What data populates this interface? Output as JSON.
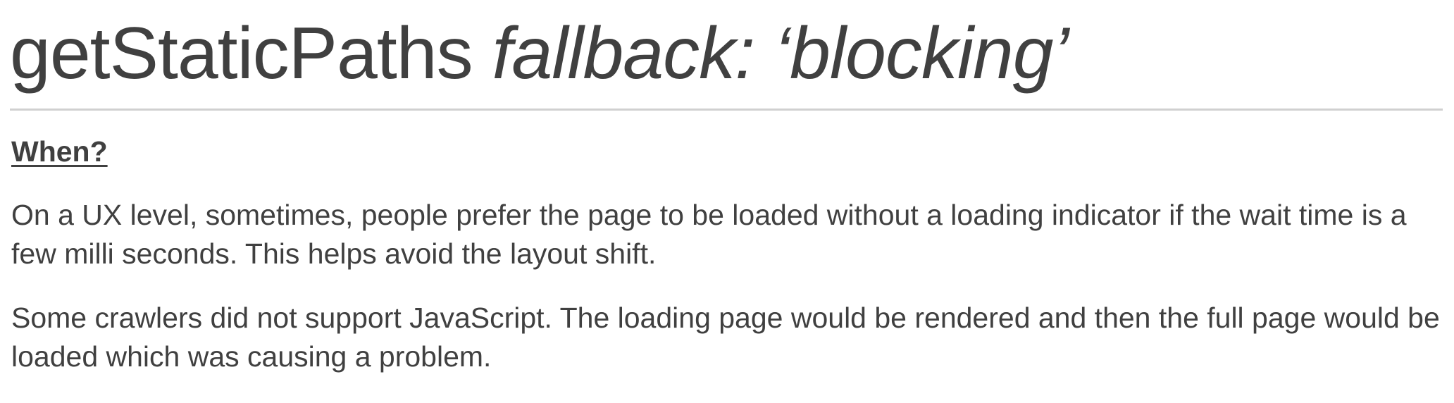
{
  "slide": {
    "title_plain": "getStaticPaths ",
    "title_emphasis": "fallback: ‘blocking’",
    "section_label": "When?",
    "paragraphs": [
      "On a UX level, sometimes, people prefer the page to be loaded without a loading indicator if the wait time is a few milli seconds. This helps avoid the layout shift.",
      "Some crawlers did not support JavaScript. The loading page would be rendered and then the full page would be loaded which was causing a problem."
    ]
  }
}
